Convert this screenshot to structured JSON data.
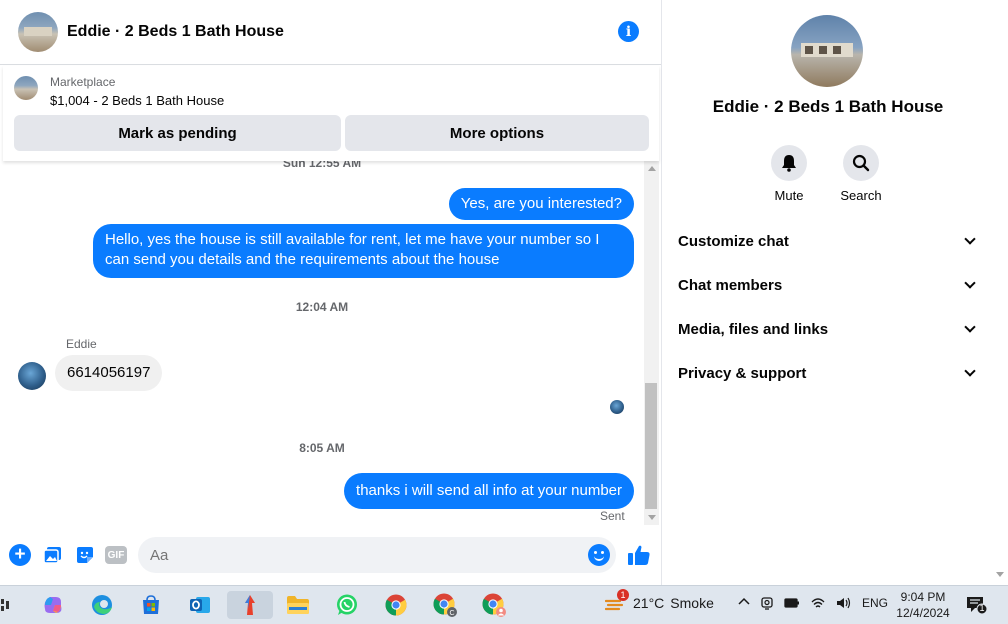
{
  "chat": {
    "title": "Eddie · 2 Beds 1 Bath House",
    "marketplace": {
      "label": "Marketplace",
      "listing": "$1,004 - 2 Beds 1 Bath House",
      "pending_btn": "Mark as pending",
      "more_btn": "More options"
    },
    "messages": {
      "clipped_ts": "Sun 12:55 AM",
      "out1": "Yes, are you interested?",
      "out2": "Hello, yes the house is still available for rent, let me have your number so I can send you details and the requirements about the house",
      "ts2": "12:04 AM",
      "sender": "Eddie",
      "in1": "6614056197",
      "ts3": "8:05 AM",
      "out3": "thanks i will send all info at your number",
      "status": "Sent"
    },
    "composer": {
      "placeholder": "Aa",
      "gif_label": "GIF"
    }
  },
  "info": {
    "name": "Eddie · 2 Beds 1 Bath House",
    "actions": {
      "mute": "Mute",
      "search": "Search"
    },
    "sections": [
      "Customize chat",
      "Chat members",
      "Media, files and links",
      "Privacy & support"
    ]
  },
  "taskbar": {
    "weather_badge": "1",
    "temperature": "21°C",
    "weather": "Smoke",
    "lang": "ENG",
    "time": "9:04 PM",
    "date": "12/4/2024",
    "notif_count": "1"
  },
  "colors": {
    "accent": "#0a7cff",
    "bubble_in": "#f0f0f0",
    "button_bg": "#e4e6eb",
    "taskbar": "#dfe6ee"
  }
}
